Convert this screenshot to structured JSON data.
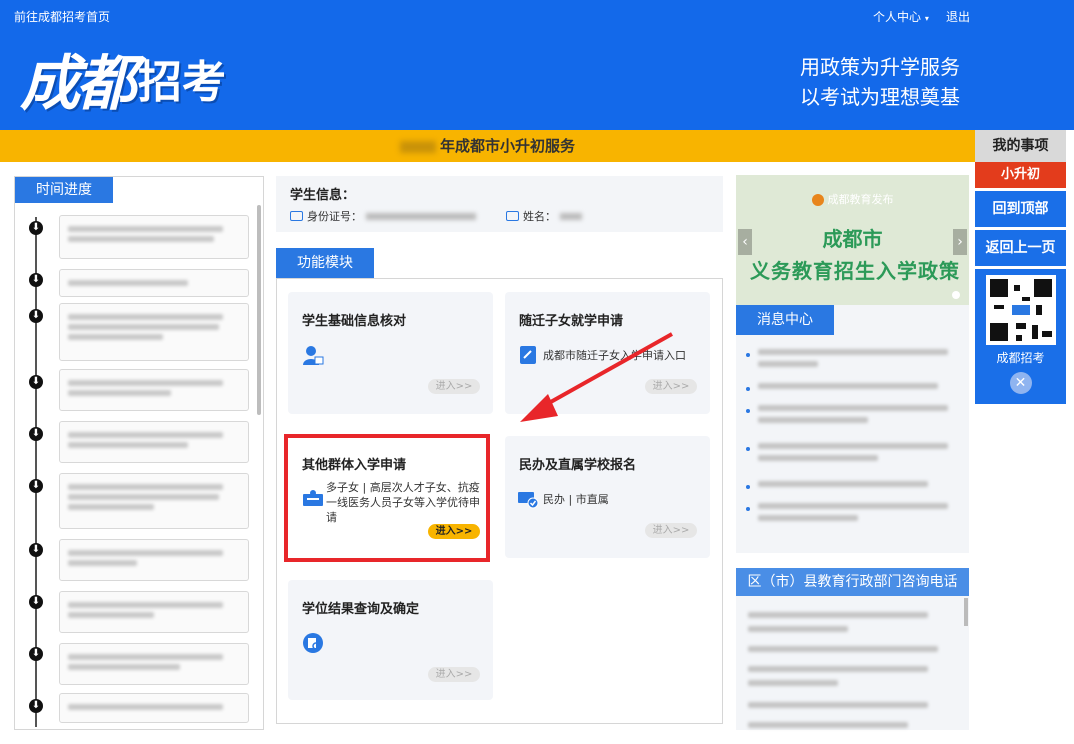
{
  "topbar": {
    "home_link": "前往成都招考首页",
    "personal_center": "个人中心",
    "logout": "退出"
  },
  "logo": {
    "main": "成都",
    "sub": "招考"
  },
  "slogan": {
    "line1": "用政策为升学服务",
    "line2": "以考试为理想奠基"
  },
  "service_title": "年成都市小升初服务",
  "right_sidebar": {
    "title": "我的事项",
    "active_item": "小升初",
    "back_to_top": "回到顶部",
    "back": "返回上一页",
    "qr_caption": "成都招考",
    "close_icon": "close-icon"
  },
  "timeline": {
    "title": "时间进度"
  },
  "student": {
    "label": "学生信息：",
    "id_label": "身份证号：",
    "name_label": "姓名："
  },
  "module_tab": "功能模块",
  "cards": {
    "basic_info": {
      "title": "学生基础信息核对",
      "enter": "进入>>"
    },
    "migrant": {
      "title": "随迁子女就学申请",
      "desc": "成都市随迁子女入学申请入口",
      "enter": "进入>>"
    },
    "other_groups": {
      "title": "其他群体入学申请",
      "desc": "多子女 | 高层次人才子女、抗疫一线医务人员子女等入学优待申请",
      "enter": "进入>>"
    },
    "private_schools": {
      "title": "民办及直属学校报名",
      "desc": "民办 | 市直属",
      "enter": "进入>>"
    },
    "result": {
      "title": "学位结果查询及确定",
      "enter": "进入>>"
    }
  },
  "banner": {
    "source": "成都教育发布",
    "line1": "成都市",
    "line2": "义务教育招生入学政策"
  },
  "news": {
    "title": "消息中心"
  },
  "phone": {
    "title": "区（市）县教育行政部门咨询电话"
  },
  "colors": {
    "header_blue": "#1369ea",
    "accent_yellow": "#f8b400",
    "highlight_red": "#e8262a",
    "tab_blue": "#2a78e2"
  }
}
